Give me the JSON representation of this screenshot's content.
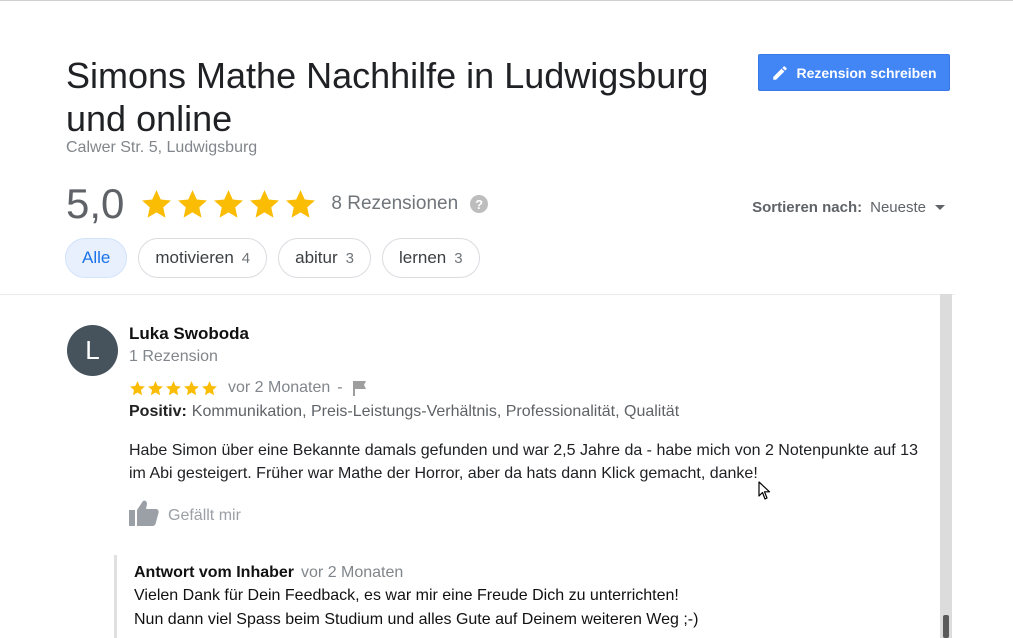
{
  "business": {
    "title": "Simons Mathe Nachhilfe in Ludwigsburg und online",
    "address": "Calwer Str. 5, Ludwigsburg",
    "write_review_label": "Rezension schreiben"
  },
  "summary": {
    "rating": "5,0",
    "stars": 5,
    "review_count": "8 Rezensionen",
    "help_glyph": "?"
  },
  "sort": {
    "label": "Sortieren nach:",
    "value": "Neueste"
  },
  "filters": [
    {
      "label": "Alle",
      "count": ""
    },
    {
      "label": "motivieren",
      "count": "4"
    },
    {
      "label": "abitur",
      "count": "3"
    },
    {
      "label": "lernen",
      "count": "3"
    }
  ],
  "review": {
    "avatar_letter": "L",
    "name": "Luka Swoboda",
    "sub": "1 Rezension",
    "stars": 5,
    "time": "vor 2 Monaten",
    "separator": "-",
    "positive_label": "Positiv:",
    "positive_text": "Kommunikation, Preis-Leistungs-Verhältnis, Professionalität, Qualität",
    "text": "Habe Simon über eine Bekannte damals gefunden und war 2,5 Jahre da - habe mich von 2 Notenpunkte auf 13 im Abi gesteigert. Früher war Mathe der Horror, aber da hats dann Klick gemacht, danke!",
    "like_label": "Gefällt mir"
  },
  "owner_reply": {
    "label": "Antwort vom Inhaber",
    "time": "vor 2 Monaten",
    "line1": "Vielen Dank für Dein Feedback, es war mir eine Freude Dich zu unterrichten!",
    "line2": "Nun dann viel Spass beim Studium und alles Gute auf Deinem weiteren Weg ;-)"
  },
  "colors": {
    "star": "#fbbc04",
    "primary_button": "#4285f4",
    "chip_active_bg": "#e8f0fe",
    "chip_active_text": "#1a73e8"
  },
  "icons": {
    "pencil": "pencil-icon",
    "star": "star-icon",
    "help": "help-icon",
    "flag": "flag-icon",
    "thumbs_up": "thumbs-up-icon",
    "caret": "caret-down-icon",
    "cursor": "mouse-cursor-icon"
  }
}
